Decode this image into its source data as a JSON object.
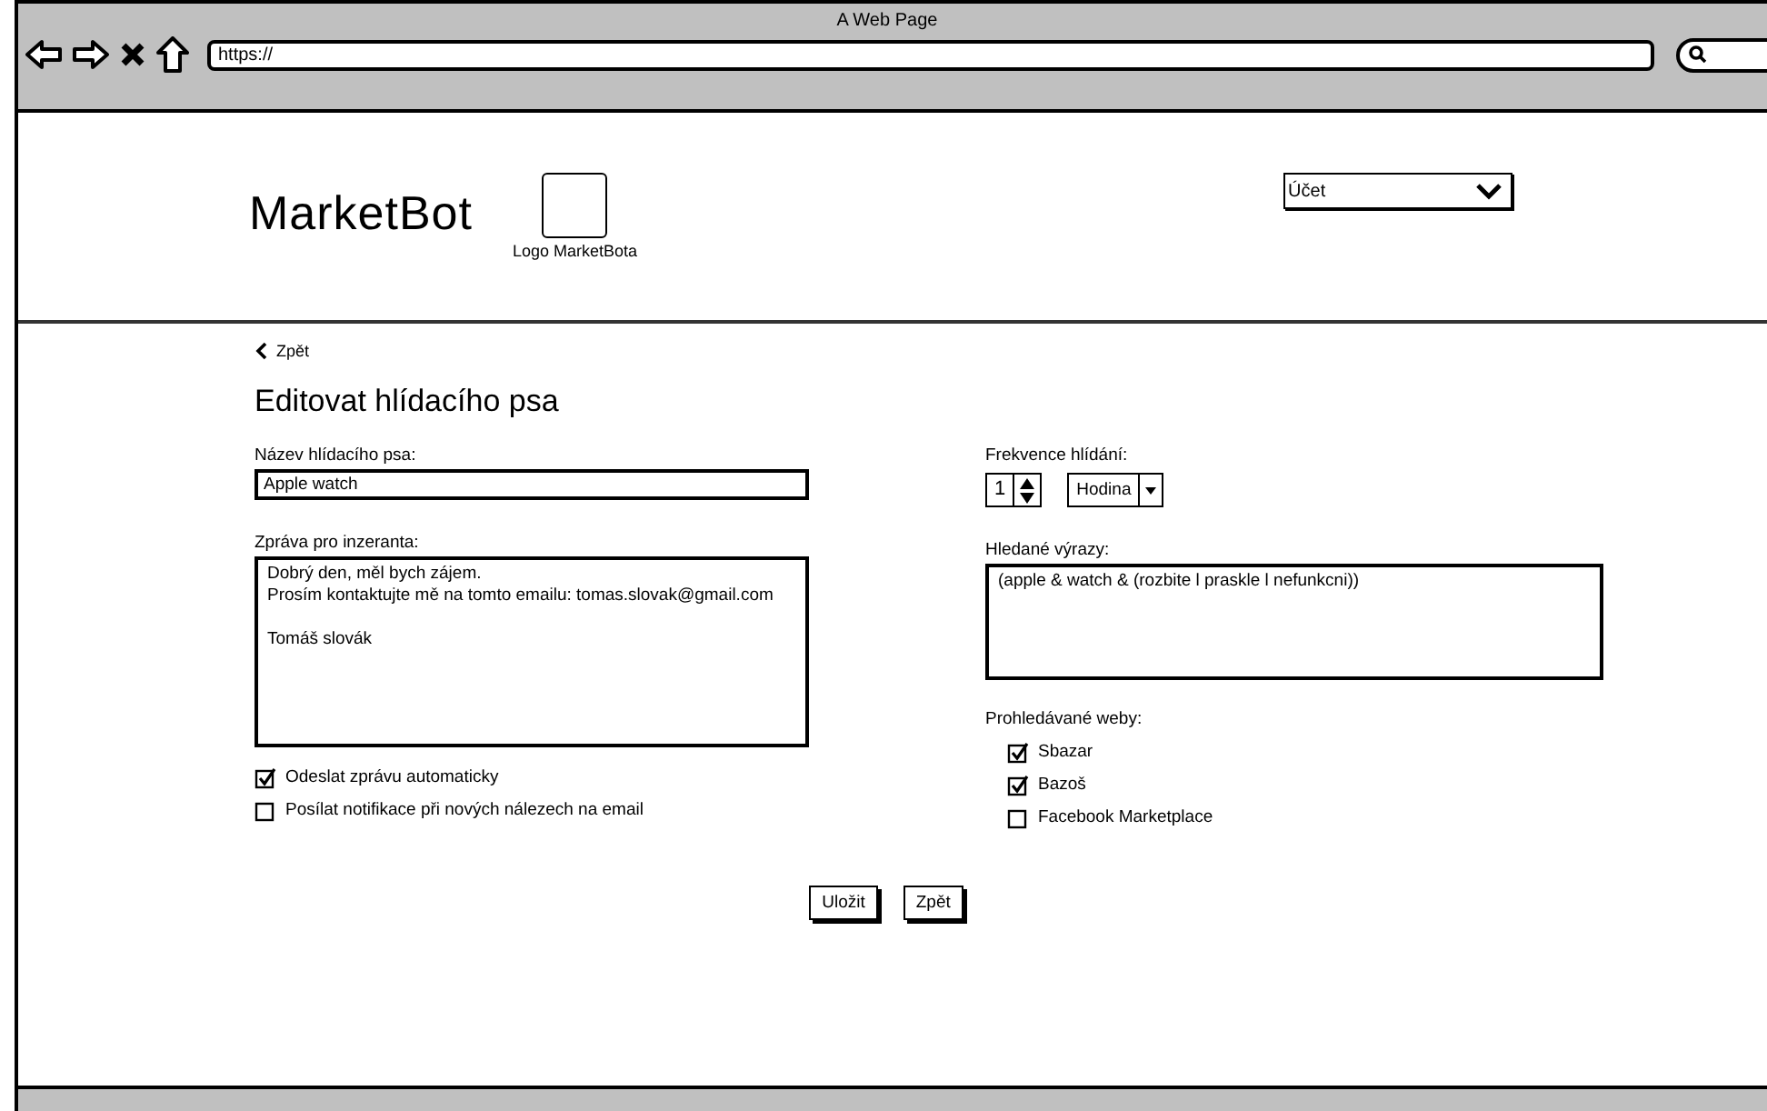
{
  "browser": {
    "title": "A Web Page",
    "url": "https://"
  },
  "header": {
    "brand": "MarketBot",
    "logo_caption": "Logo MarketBota",
    "account_menu": "Účet"
  },
  "back_link": "Zpět",
  "title": "Editovat hlídacího psa",
  "name_field": {
    "label": "Název hlídacího psa:",
    "value": "Apple watch"
  },
  "message_field": {
    "label": "Zpráva pro inzeranta:",
    "paragraphs": [
      [
        "Dobrý den, měl bych zájem.",
        "Prosím kontaktujte mě na tomto emailu: tomas.slovak@gmail.com"
      ],
      [
        "Tomáš slovák"
      ]
    ]
  },
  "options": [
    {
      "label": "Odeslat zprávu automaticky",
      "checked": true
    },
    {
      "label": "Posílat notifikace při nových nálezech na email",
      "checked": false
    }
  ],
  "frequency": {
    "label": "Frekvence hlídání:",
    "count": "1",
    "unit": "Hodina"
  },
  "search_terms": {
    "label": "Hledané výrazy:",
    "value": "(apple & watch & (rozbite l praskle l nefunkcni))"
  },
  "sites": {
    "label": "Prohledávané weby:",
    "items": [
      {
        "label": "Sbazar",
        "checked": true
      },
      {
        "label": "Bazoš",
        "checked": true
      },
      {
        "label": "Facebook Marketplace",
        "checked": false
      }
    ]
  },
  "buttons": [
    "Uložit",
    "Zpět"
  ]
}
